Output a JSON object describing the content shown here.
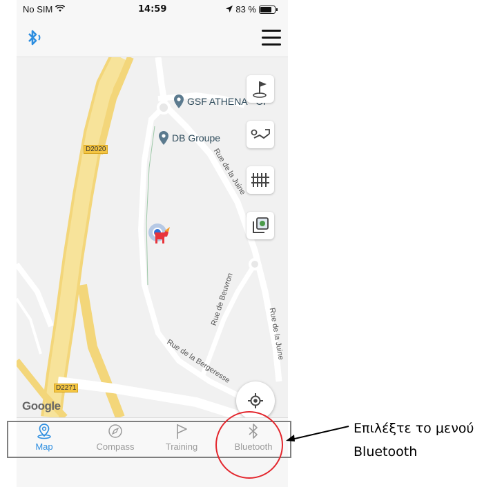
{
  "status_bar": {
    "carrier": "No SIM",
    "time": "14:59",
    "battery": "83 %",
    "battery_level": 0.83
  },
  "map": {
    "pois": [
      "GSF ATHENA - Or",
      "DB Groupe"
    ],
    "road_shields": [
      "D2020",
      "D2271"
    ],
    "streets": [
      "Rue de la Juine",
      "Rue de Beuvron",
      "Rue de la Bergeresse",
      "Rue de la Juine"
    ],
    "attribution": "Google",
    "controls": [
      "flag-pin-icon",
      "route-icon",
      "fence-icon",
      "map-layers-icon"
    ]
  },
  "tabs": [
    {
      "label": "Map",
      "icon": "map-pin-icon",
      "active": true
    },
    {
      "label": "Compass",
      "icon": "compass-icon",
      "active": false
    },
    {
      "label": "Training",
      "icon": "flag-icon",
      "active": false
    },
    {
      "label": "Bluetooth",
      "icon": "bluetooth-icon",
      "active": false
    }
  ],
  "annotation": {
    "line1": "Επιλέξτε το μενού",
    "line2": "Bluetooth"
  },
  "colors": {
    "accent": "#2d8ee0",
    "highway": "#f6d86a",
    "callout_circle": "#e3262d",
    "tab_inactive": "#9a9a9a"
  }
}
